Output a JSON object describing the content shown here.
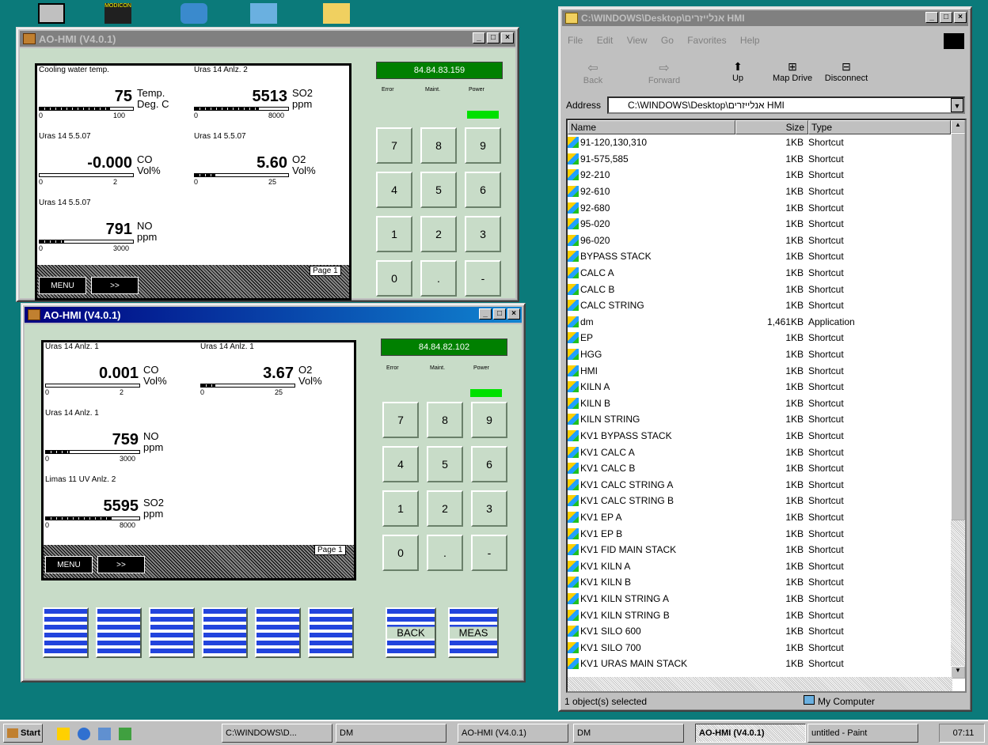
{
  "desktop": {
    "icon_label": "MODICON"
  },
  "hmi_top": {
    "title": "AO-HMI (V4.0.1)",
    "ip": "84.84.83.159",
    "status_labels": [
      "Error",
      "Maint.",
      "Power"
    ],
    "page": "Page 1",
    "menu_label": "MENU",
    "next_label": ">>",
    "cells": [
      {
        "header": "Cooling water temp.",
        "value": "75",
        "unit1": "Temp.",
        "unit2": "Deg. C",
        "min": "0",
        "max": "100",
        "level": 0.75
      },
      {
        "header": "Uras 14 Anlz. 2",
        "value": "5513",
        "unit1": "SO2",
        "unit2": "ppm",
        "min": "0",
        "max": "8000",
        "level": 0.69
      },
      {
        "header": "Uras 14 5.5.07",
        "value": "-0.000",
        "unit1": "CO",
        "unit2": "Vol%",
        "min": "0",
        "max": "2",
        "level": 0
      },
      {
        "header": "Uras 14 5.5.07",
        "value": "5.60",
        "unit1": "O2",
        "unit2": "Vol%",
        "min": "0",
        "max": "25",
        "level": 0.22
      },
      {
        "header": "Uras 14 5.5.07",
        "value": "791",
        "unit1": "NO",
        "unit2": "ppm",
        "min": "0",
        "max": "3000",
        "level": 0.26
      }
    ],
    "keys": [
      "7",
      "8",
      "9",
      "4",
      "5",
      "6",
      "1",
      "2",
      "3",
      "0",
      ".",
      "-"
    ]
  },
  "hmi_bottom": {
    "title": "AO-HMI (V4.0.1)",
    "ip": "84.84.82.102",
    "status_labels": [
      "Error",
      "Maint.",
      "Power"
    ],
    "page": "Page 1",
    "menu_label": "MENU",
    "next_label": ">>",
    "cells": [
      {
        "header": "Uras 14 Anlz. 1",
        "value": "0.001",
        "unit1": "CO",
        "unit2": "Vol%",
        "min": "0",
        "max": "2",
        "level": 0.0005
      },
      {
        "header": "Uras 14 Anlz. 1",
        "value": "3.67",
        "unit1": "O2",
        "unit2": "Vol%",
        "min": "0",
        "max": "25",
        "level": 0.15
      },
      {
        "header": "Uras 14 Anlz. 1",
        "value": "759",
        "unit1": "NO",
        "unit2": "ppm",
        "min": "0",
        "max": "3000",
        "level": 0.25
      },
      {
        "header": "Limas 11 UV Anlz. 2",
        "value": "5595",
        "unit1": "SO2",
        "unit2": "ppm",
        "min": "0",
        "max": "8000",
        "level": 0.7
      }
    ],
    "keys": [
      "7",
      "8",
      "9",
      "4",
      "5",
      "6",
      "1",
      "2",
      "3",
      "0",
      ".",
      "-"
    ],
    "soft_keys": [
      "",
      "",
      "",
      "",
      "",
      ""
    ],
    "back_label": "BACK",
    "meas_label": "MEAS"
  },
  "explorer": {
    "title": "C:\\WINDOWS\\Desktop\\אנלייזרים HMI",
    "menu": [
      "File",
      "Edit",
      "View",
      "Go",
      "Favorites",
      "Help"
    ],
    "toolbar": [
      "Back",
      "Forward",
      "Up",
      "Map Drive",
      "Disconnect"
    ],
    "address_label": "Address",
    "address": "C:\\WINDOWS\\Desktop\\אנלייזרים HMI",
    "columns": [
      "Name",
      "Size",
      "Type"
    ],
    "files": [
      [
        "91-120,130,310",
        "1KB",
        "Shortcut"
      ],
      [
        "91-575,585",
        "1KB",
        "Shortcut"
      ],
      [
        "92-210",
        "1KB",
        "Shortcut"
      ],
      [
        "92-610",
        "1KB",
        "Shortcut"
      ],
      [
        "92-680",
        "1KB",
        "Shortcut"
      ],
      [
        "95-020",
        "1KB",
        "Shortcut"
      ],
      [
        "96-020",
        "1KB",
        "Shortcut"
      ],
      [
        "BYPASS STACK",
        "1KB",
        "Shortcut"
      ],
      [
        "CALC A",
        "1KB",
        "Shortcut"
      ],
      [
        "CALC B",
        "1KB",
        "Shortcut"
      ],
      [
        "CALC STRING",
        "1KB",
        "Shortcut"
      ],
      [
        "dm",
        "1,461KB",
        "Application"
      ],
      [
        "EP",
        "1KB",
        "Shortcut"
      ],
      [
        "HGG",
        "1KB",
        "Shortcut"
      ],
      [
        "HMI",
        "1KB",
        "Shortcut"
      ],
      [
        "KILN A",
        "1KB",
        "Shortcut"
      ],
      [
        "KILN B",
        "1KB",
        "Shortcut"
      ],
      [
        "KILN STRING",
        "1KB",
        "Shortcut"
      ],
      [
        "KV1 BYPASS STACK",
        "1KB",
        "Shortcut"
      ],
      [
        "KV1 CALC A",
        "1KB",
        "Shortcut"
      ],
      [
        "KV1 CALC B",
        "1KB",
        "Shortcut"
      ],
      [
        "KV1 CALC STRING A",
        "1KB",
        "Shortcut"
      ],
      [
        "KV1 CALC STRING B",
        "1KB",
        "Shortcut"
      ],
      [
        "KV1 EP A",
        "1KB",
        "Shortcut"
      ],
      [
        "KV1 EP B",
        "1KB",
        "Shortcut"
      ],
      [
        "KV1 FID MAIN STACK",
        "1KB",
        "Shortcut"
      ],
      [
        "KV1 KILN A",
        "1KB",
        "Shortcut"
      ],
      [
        "KV1 KILN B",
        "1KB",
        "Shortcut"
      ],
      [
        "KV1 KILN STRING A",
        "1KB",
        "Shortcut"
      ],
      [
        "KV1 KILN STRING B",
        "1KB",
        "Shortcut"
      ],
      [
        "KV1 SILO 600",
        "1KB",
        "Shortcut"
      ],
      [
        "KV1 SILO 700",
        "1KB",
        "Shortcut"
      ],
      [
        "KV1 URAS MAIN STACK",
        "1KB",
        "Shortcut"
      ]
    ],
    "status_left": "1 object(s) selected",
    "status_right": "My Computer"
  },
  "taskbar": {
    "start": "Start",
    "tasks": [
      "C:\\WINDOWS\\D...",
      "DM",
      "AO-HMI (V4.0.1)",
      "DM",
      "AO-HMI (V4.0.1)",
      "untitled - Paint"
    ],
    "clock": "07:11"
  }
}
